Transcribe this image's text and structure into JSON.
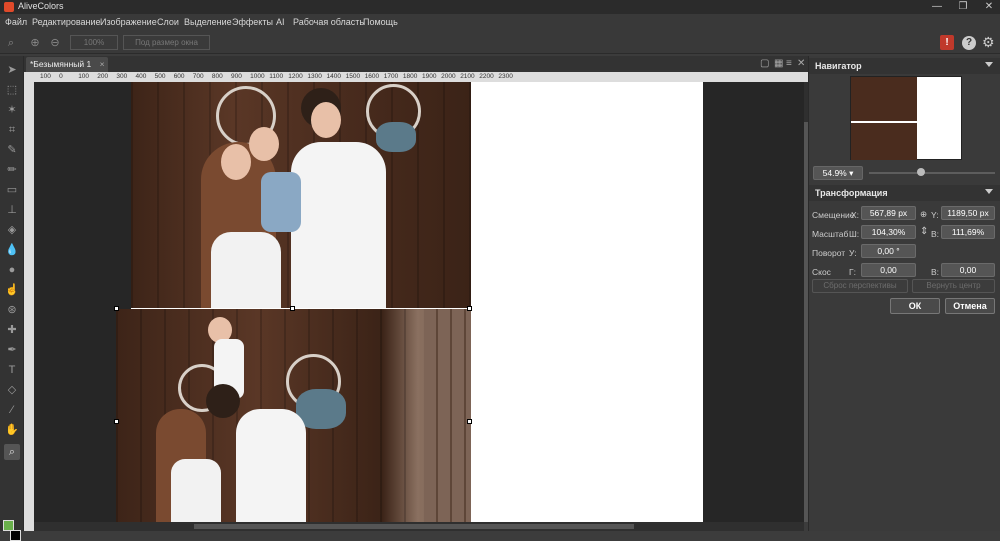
{
  "app": {
    "title": "AliveColors"
  },
  "window_buttons": [
    "—",
    "❐",
    "✕"
  ],
  "menu": [
    "Файл",
    "Редактирование",
    "Изображение",
    "Слои",
    "Выделение",
    "Эффекты",
    "AI",
    "Рабочая область",
    "Помощь"
  ],
  "options": {
    "zoom_value": "100%",
    "fit_label": "Под размер окна"
  },
  "document": {
    "tab_label": "*Безымянный 1",
    "close": "×"
  },
  "ruler": {
    "ticks": [
      "100",
      "0",
      "100",
      "200",
      "300",
      "400",
      "500",
      "600",
      "700",
      "800",
      "900",
      "1000",
      "1100",
      "1200",
      "1300",
      "1400",
      "1500",
      "1600",
      "1700",
      "1800",
      "1900",
      "2000",
      "2100",
      "2200",
      "2300"
    ]
  },
  "navigator": {
    "title": "Навигатор",
    "zoom": "54.9%",
    "zoom_level": 0.549
  },
  "transform": {
    "title": "Трансформация",
    "offset_label": "Смещение",
    "x_label": "X:",
    "x_value": "567,89 px",
    "y_label": "Y:",
    "y_value": "1189,50 px",
    "scale_label": "Масштаб",
    "w_label": "Ш:",
    "w_value": "104,30%",
    "h_label": "В:",
    "h_value": "111,69%",
    "rotate_label": "Поворот",
    "u_label": "У:",
    "u_value": "0,00 °",
    "skew_label": "Скос",
    "g_label": "Г:",
    "g_value": "0,00",
    "v_label": "В:",
    "v_value": "0,00",
    "reset_perspective": "Сброс перспективы",
    "return_center": "Вернуть центр",
    "ok": "ОК",
    "cancel": "Отмена"
  },
  "colors": {
    "foreground": "#6ab04c",
    "background": "#000000",
    "accent": "#c0392b"
  }
}
